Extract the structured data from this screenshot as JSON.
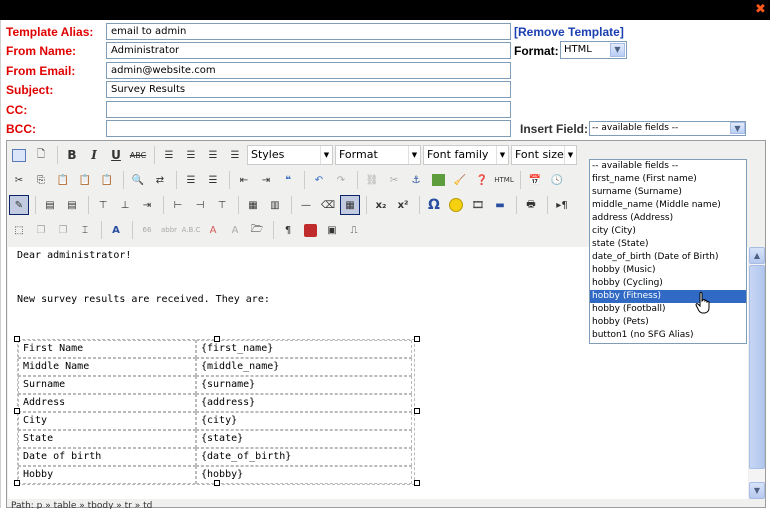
{
  "form": {
    "alias_label": "Template Alias:",
    "alias_value": "email to admin",
    "from_name_label": "From Name:",
    "from_name_value": "Administrator",
    "from_email_label": "From Email:",
    "from_email_value": "admin@website.com",
    "subject_label": "Subject:",
    "subject_value": "Survey Results",
    "cc_label": "CC:",
    "cc_value": "",
    "bcc_label": "BCC:",
    "bcc_value": ""
  },
  "remove_template": {
    "prefix": "[",
    "label": "Remove Template",
    "suffix": "]"
  },
  "format": {
    "label": "Format:",
    "value": "HTML"
  },
  "insert_field": {
    "label": "Insert Field:",
    "value": "-- available fields --",
    "options": [
      "-- available fields --",
      "first_name (First name)",
      "surname (Surname)",
      "middle_name (Middle name)",
      "address (Address)",
      "city (City)",
      "state (State)",
      "date_of_birth (Date of Birth)",
      "hobby (Music)",
      "hobby (Cycling)",
      "hobby (Fitness)",
      "hobby (Football)",
      "hobby (Pets)",
      "button1 (no SFG Alias)"
    ],
    "highlighted_index": 10
  },
  "toolbar": {
    "styles": "Styles",
    "format": "Format",
    "font_family": "Font family",
    "font_size": "Font size",
    "bold": "B",
    "italic": "I",
    "underline": "U",
    "strike": "ABC",
    "html": "HTML",
    "omega": "Ω",
    "sub": "x₂",
    "sup": "x²",
    "pilcrow": "¶"
  },
  "content": {
    "greeting": "Dear administrator!",
    "intro": "New survey results are received. They are:",
    "rows": [
      [
        "First Name",
        "{first_name}"
      ],
      [
        "Middle Name",
        "{middle_name}"
      ],
      [
        "Surname",
        "{surname}"
      ],
      [
        "Address",
        "{address}"
      ],
      [
        "City",
        "{city}"
      ],
      [
        "State",
        "{state}"
      ],
      [
        "Date of birth",
        "{date_of_birth}"
      ],
      [
        "Hobby",
        "{hobby}"
      ]
    ]
  },
  "status_path": "Path: p » table » tbody » tr » td",
  "colors": {
    "label_red": "#e00000",
    "link_blue": "#1a3fb0",
    "highlight": "#316ac5",
    "close_orange": "#ff5a1e"
  }
}
